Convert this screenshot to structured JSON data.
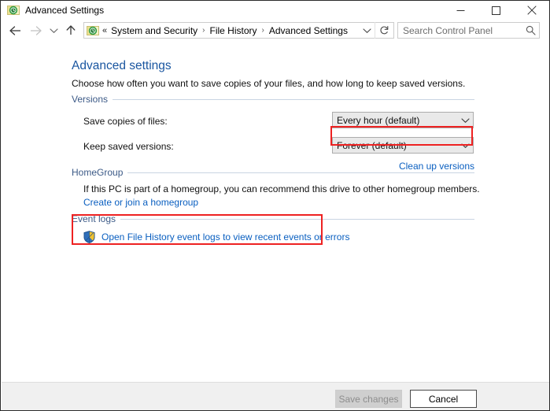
{
  "window": {
    "title": "Advanced Settings",
    "app_icon": "file-history-icon",
    "controls": {
      "minimize": "minimize-icon",
      "maximize": "maximize-icon",
      "close": "close-icon"
    }
  },
  "navbar": {
    "back": "back-arrow-icon",
    "forward": "forward-arrow-icon",
    "recent": "recent-locations-chevron-icon",
    "up": "up-arrow-icon",
    "address_icon": "file-history-icon",
    "breadcrumb_overflow": "«",
    "breadcrumbs": [
      "System and Security",
      "File History",
      "Advanced Settings"
    ],
    "separator": "›",
    "address_dropdown": "chevron-down-icon",
    "refresh": "refresh-icon",
    "search": {
      "placeholder": "Search Control Panel",
      "value": "",
      "icon": "search-icon"
    }
  },
  "page": {
    "title": "Advanced settings",
    "subtitle": "Choose how often you want to save copies of your files, and how long to keep saved versions."
  },
  "versions": {
    "group_label": "Versions",
    "save_copies": {
      "label": "Save copies of files:",
      "value": "Every hour (default)",
      "arrow": "chevron-down-icon"
    },
    "keep_versions": {
      "label": "Keep saved versions:",
      "value": "Forever (default)",
      "arrow": "chevron-down-icon"
    },
    "clean_up_link": "Clean up versions"
  },
  "homegroup": {
    "group_label": "HomeGroup",
    "description": "If this PC is part of a homegroup, you can recommend this drive to other homegroup members.",
    "link": "Create or join a homegroup"
  },
  "event_logs": {
    "group_label": "Event logs",
    "shield_icon": "uac-shield-icon",
    "link": "Open File History event logs to view recent events or errors"
  },
  "footer": {
    "save_label": "Save changes",
    "cancel_label": "Cancel"
  },
  "colors": {
    "title_blue": "#1a56a0",
    "link_blue": "#0a5fc0",
    "group_label_blue": "#3c5a87",
    "annotation_red": "#ee2222",
    "footer_bg": "#f0f0f0"
  }
}
